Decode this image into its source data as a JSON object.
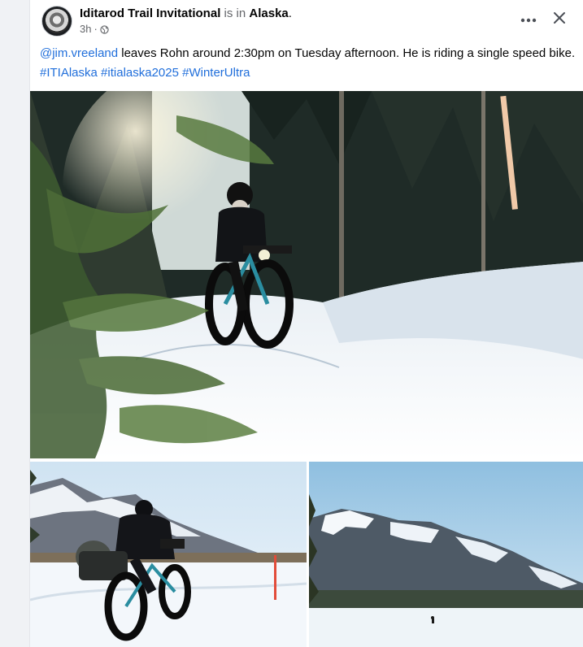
{
  "post": {
    "page_name": "Iditarod Trail Invitational",
    "is_in": "is in",
    "location": "Alaska",
    "location_suffix": ".",
    "time": "3h",
    "dot": "·",
    "privacy_icon": "globe-icon",
    "more_icon": "more-horizontal-icon",
    "close_icon": "close-icon",
    "mention": "@jim.vreeland",
    "body": " leaves Rohn around 2:30pm on Tuesday afternoon. He is riding a single speed bike.",
    "hashtags": [
      "#ITIAlaska",
      "#itialaska2025",
      "#WinterUltra"
    ]
  },
  "colors": {
    "link": "#216fdb",
    "text": "#050505",
    "secondary": "#65676b"
  }
}
